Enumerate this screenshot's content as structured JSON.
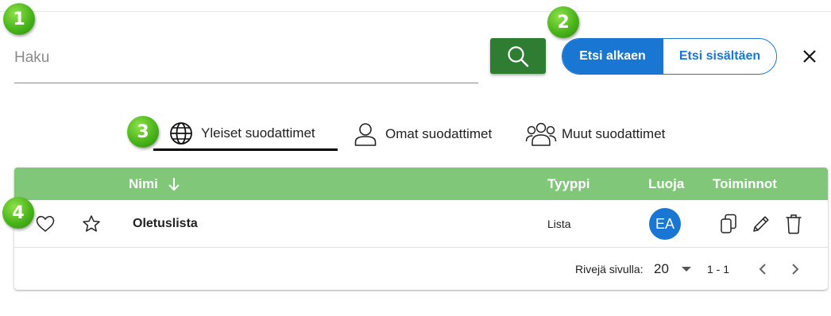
{
  "search": {
    "placeholder": "Haku",
    "value": ""
  },
  "search_mode": {
    "starts_with_label": "Etsi alkaen",
    "contains_label": "Etsi sisältäen",
    "selected": "Etsi alkaen"
  },
  "badges": [
    "1",
    "2",
    "3",
    "4"
  ],
  "tabs": [
    {
      "label": "Yleiset suodattimet",
      "icon": "globe-icon",
      "active": true
    },
    {
      "label": "Omat suodattimet",
      "icon": "person-icon",
      "active": false
    },
    {
      "label": "Muut suodattimet",
      "icon": "people-icon",
      "active": false
    }
  ],
  "table": {
    "headers": {
      "name": "Nimi",
      "type": "Tyyppi",
      "creator": "Luoja",
      "actions": "Toiminnot"
    },
    "sort": "descending-arrow",
    "rows": [
      {
        "name": "Oletuslista",
        "type": "Lista",
        "creator_initials": "EA",
        "favorite": false,
        "starred": false
      }
    ]
  },
  "pagination": {
    "rows_per_page_label": "Rivejä sivulla:",
    "rows_per_page": "20",
    "range": "1 - 1"
  },
  "colors": {
    "primary": "#1976d2",
    "search_button": "#2e7d32",
    "table_header": "#81c77a",
    "badge": "#49b51a"
  }
}
